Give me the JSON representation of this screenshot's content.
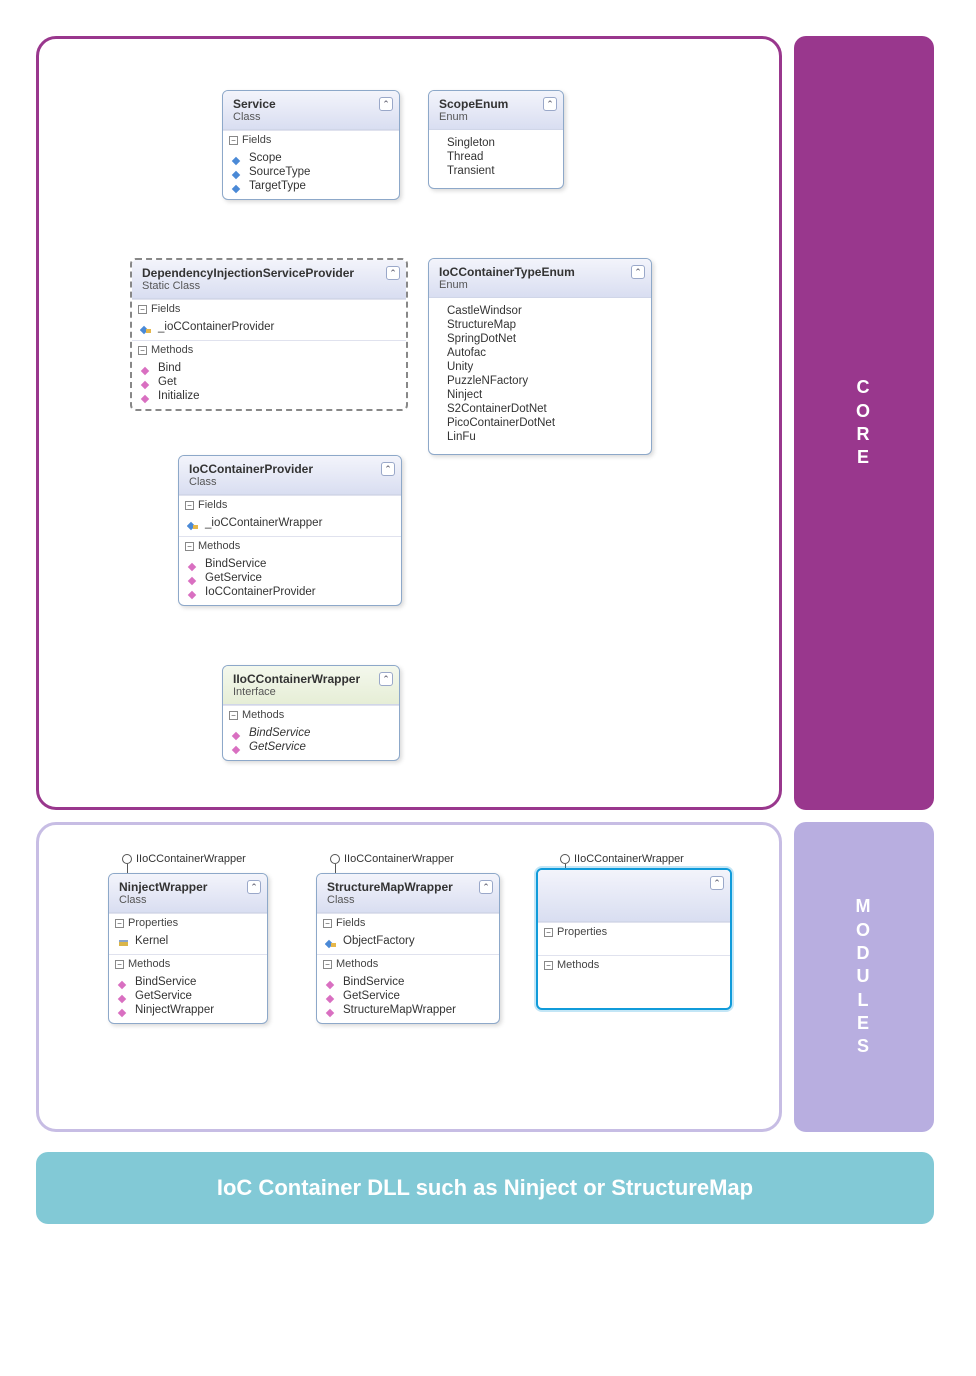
{
  "layout": {
    "core_label": "CORE",
    "modules_label": "MODULES",
    "footer": "IoC Container DLL such as Ninject or StructureMap"
  },
  "sections": {
    "fields": "Fields",
    "methods": "Methods",
    "properties": "Properties"
  },
  "interface_lollipop": "IIoCContainerWrapper",
  "classes": {
    "service": {
      "title": "Service",
      "stereotype": "Class",
      "fields": [
        "Scope",
        "SourceType",
        "TargetType"
      ]
    },
    "scopeEnum": {
      "title": "ScopeEnum",
      "stereotype": "Enum",
      "items": [
        "Singleton",
        "Thread",
        "Transient"
      ]
    },
    "disp": {
      "title": "DependencyInjectionServiceProvider",
      "stereotype": "Static Class",
      "fields": [
        "_ioCContainerProvider"
      ],
      "methods": [
        "Bind",
        "Get",
        "Initialize"
      ]
    },
    "containerType": {
      "title": "IoCContainerTypeEnum",
      "stereotype": "Enum",
      "items": [
        "CastleWindsor",
        "StructureMap",
        "SpringDotNet",
        "Autofac",
        "Unity",
        "PuzzleNFactory",
        "Ninject",
        "S2ContainerDotNet",
        "PicoContainerDotNet",
        "LinFu"
      ]
    },
    "provider": {
      "title": "IoCContainerProvider",
      "stereotype": "Class",
      "fields": [
        "_ioCContainerWrapper"
      ],
      "methods": [
        "BindService",
        "GetService",
        "IoCContainerProvider"
      ]
    },
    "iwrapper": {
      "title": "IIoCContainerWrapper",
      "stereotype": "Interface",
      "methods": [
        "BindService",
        "GetService"
      ]
    },
    "ninject": {
      "title": "NinjectWrapper",
      "stereotype": "Class",
      "properties": [
        "Kernel"
      ],
      "methods": [
        "BindService",
        "GetService",
        "NinjectWrapper"
      ]
    },
    "smap": {
      "title": "StructureMapWrapper",
      "stereotype": "Class",
      "fields": [
        "ObjectFactory"
      ],
      "methods": [
        "BindService",
        "GetService",
        "StructureMapWrapper"
      ]
    },
    "generic": {
      "title": "",
      "stereotype": "",
      "properties": [],
      "methods": []
    }
  }
}
